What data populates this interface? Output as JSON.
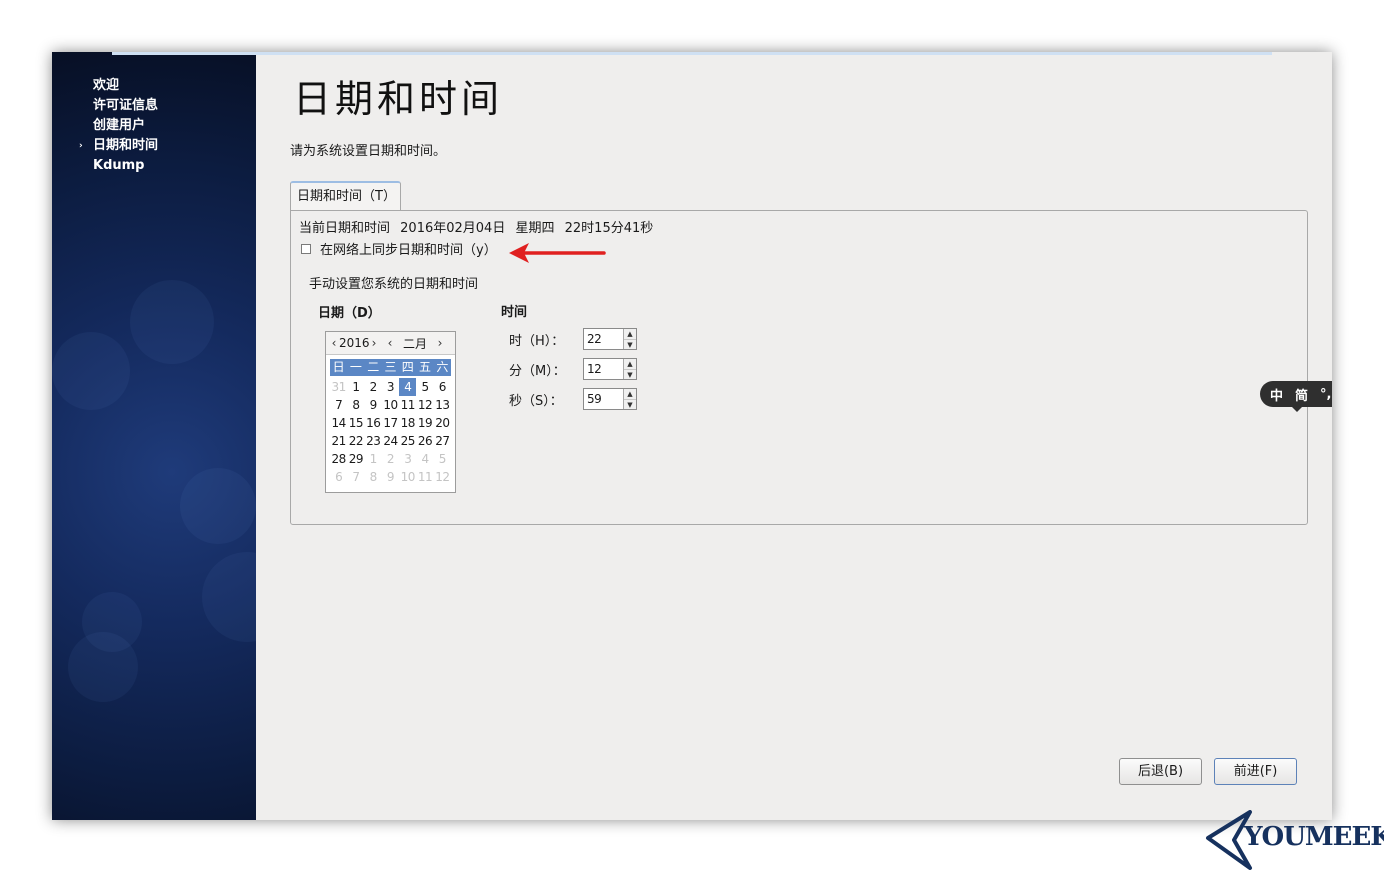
{
  "sidebar": {
    "items": [
      {
        "label": "欢迎",
        "active": false
      },
      {
        "label": "许可证信息",
        "active": false
      },
      {
        "label": "创建用户",
        "active": false
      },
      {
        "label": "日期和时间",
        "active": true
      },
      {
        "label": "Kdump",
        "active": false
      }
    ],
    "active_marker": "›"
  },
  "main": {
    "title": "日期和时间",
    "subtitle": "请为系统设置日期和时间。",
    "tab_label": "日期和时间（T）",
    "current_label": "当前日期和时间",
    "current_date": "2016年02月04日",
    "current_weekday": "星期四",
    "current_time": "22时15分41秒",
    "sync_label": "在网络上同步日期和时间（y）",
    "sync_checked": false,
    "manual_label": "手动设置您系统的日期和时间",
    "date_label": "日期（D）",
    "time_label": "时间"
  },
  "calendar": {
    "year": "2016",
    "month": "二月",
    "weekdays": [
      "日",
      "一",
      "二",
      "三",
      "四",
      "五",
      "六"
    ],
    "days": [
      {
        "d": "31",
        "other": true
      },
      {
        "d": "1"
      },
      {
        "d": "2"
      },
      {
        "d": "3"
      },
      {
        "d": "4",
        "selected": true
      },
      {
        "d": "5"
      },
      {
        "d": "6"
      },
      {
        "d": "7"
      },
      {
        "d": "8"
      },
      {
        "d": "9"
      },
      {
        "d": "10"
      },
      {
        "d": "11"
      },
      {
        "d": "12"
      },
      {
        "d": "13"
      },
      {
        "d": "14"
      },
      {
        "d": "15"
      },
      {
        "d": "16"
      },
      {
        "d": "17"
      },
      {
        "d": "18"
      },
      {
        "d": "19"
      },
      {
        "d": "20"
      },
      {
        "d": "21"
      },
      {
        "d": "22"
      },
      {
        "d": "23"
      },
      {
        "d": "24"
      },
      {
        "d": "25"
      },
      {
        "d": "26"
      },
      {
        "d": "27"
      },
      {
        "d": "28"
      },
      {
        "d": "29"
      },
      {
        "d": "1",
        "other": true
      },
      {
        "d": "2",
        "other": true
      },
      {
        "d": "3",
        "other": true
      },
      {
        "d": "4",
        "other": true
      },
      {
        "d": "5",
        "other": true
      },
      {
        "d": "6",
        "other": true
      },
      {
        "d": "7",
        "other": true
      },
      {
        "d": "8",
        "other": true
      },
      {
        "d": "9",
        "other": true
      },
      {
        "d": "10",
        "other": true
      },
      {
        "d": "11",
        "other": true
      },
      {
        "d": "12",
        "other": true
      }
    ]
  },
  "time": {
    "hour_label": "时（H）：",
    "hour_value": "22",
    "minute_label": "分（M）：",
    "minute_value": "12",
    "second_label": "秒（S）：",
    "second_value": "59"
  },
  "buttons": {
    "back": "后退(B)",
    "forward": "前进(F)"
  },
  "ime": {
    "lang": "中",
    "mode": "简",
    "punct": "°,"
  },
  "watermark": "YOUMEEK",
  "colors": {
    "accent": "#5b87c5",
    "sidebar": "#0c1c40",
    "annotation_arrow": "#e02020"
  }
}
